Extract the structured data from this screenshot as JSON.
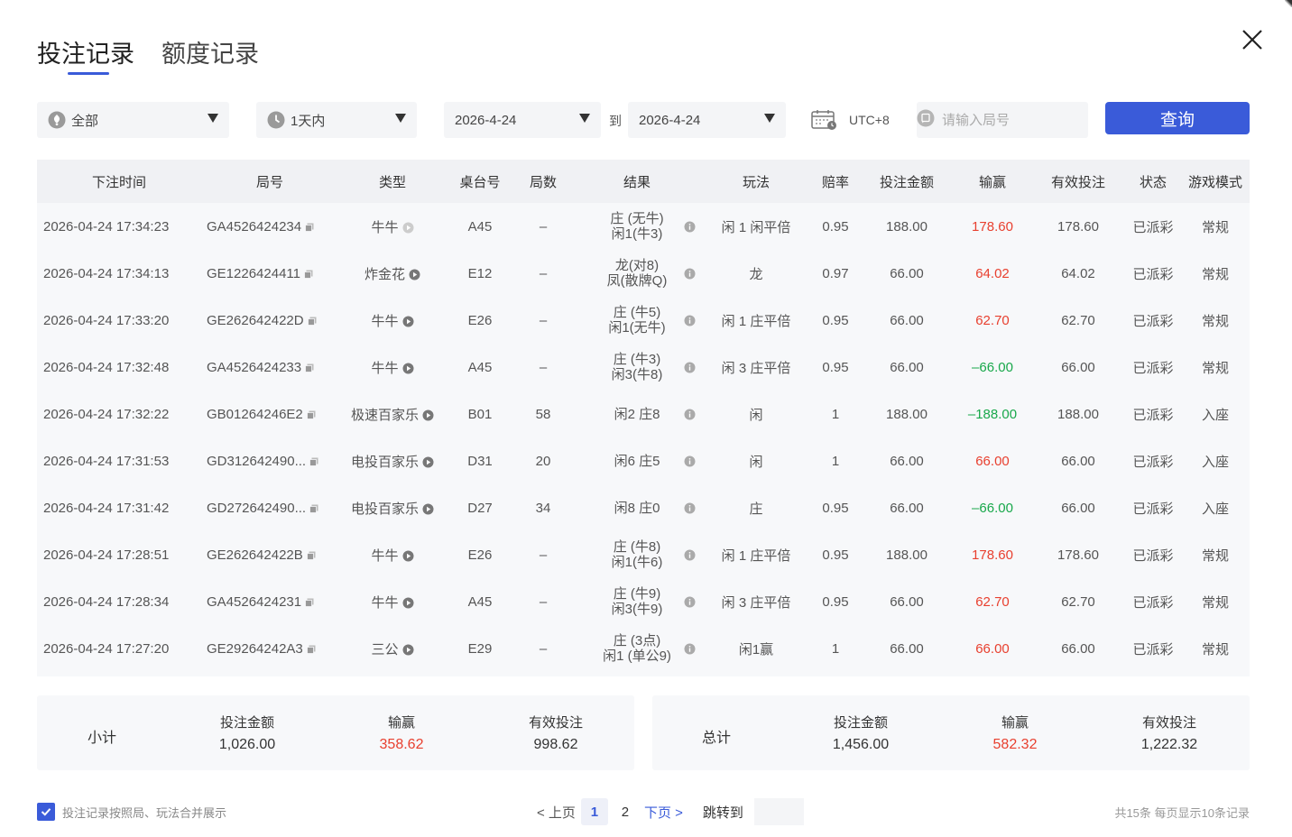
{
  "tabs": [
    {
      "label": "投注记录",
      "active": true
    },
    {
      "label": "额度记录",
      "active": false
    }
  ],
  "filters": {
    "game_type": "全部",
    "time_range": "1天内",
    "date_from": "2026-4-24",
    "to_label": "到",
    "date_to": "2026-4-24",
    "timezone": "UTC+8",
    "round_placeholder": "请输入局号",
    "query_label": "查询"
  },
  "columns": [
    "下注时间",
    "局号",
    "类型",
    "桌台号",
    "局数",
    "结果",
    "玩法",
    "赔率",
    "投注金额",
    "输赢",
    "有效投注",
    "状态",
    "游戏模式"
  ],
  "rows": [
    {
      "time": "2026-04-24 17:34:23",
      "round": "GA4526424234",
      "type": "牛牛",
      "play_enabled": false,
      "table": "A45",
      "count": "–",
      "result1": "庄 (无牛)",
      "result2": "闲1(牛3)",
      "bet_type": "闲 1 闲平倍",
      "odds": "0.95",
      "amount": "188.00",
      "winloss": "178.60",
      "wl_state": "win",
      "valid": "178.60",
      "status": "已派彩",
      "mode": "常规"
    },
    {
      "time": "2026-04-24 17:34:13",
      "round": "GE1226424411",
      "type": "炸金花",
      "play_enabled": true,
      "table": "E12",
      "count": "–",
      "result1": "龙(对8)",
      "result2": "凤(散牌Q)",
      "bet_type": "龙",
      "odds": "0.97",
      "amount": "66.00",
      "winloss": "64.02",
      "wl_state": "win",
      "valid": "64.02",
      "status": "已派彩",
      "mode": "常规"
    },
    {
      "time": "2026-04-24 17:33:20",
      "round": "GE262642422D",
      "type": "牛牛",
      "play_enabled": true,
      "table": "E26",
      "count": "–",
      "result1": "庄 (牛5)",
      "result2": "闲1(无牛)",
      "bet_type": "闲 1 庄平倍",
      "odds": "0.95",
      "amount": "66.00",
      "winloss": "62.70",
      "wl_state": "win",
      "valid": "62.70",
      "status": "已派彩",
      "mode": "常规"
    },
    {
      "time": "2026-04-24 17:32:48",
      "round": "GA4526424233",
      "type": "牛牛",
      "play_enabled": true,
      "table": "A45",
      "count": "–",
      "result1": "庄 (牛3)",
      "result2": "闲3(牛8)",
      "bet_type": "闲 3 庄平倍",
      "odds": "0.95",
      "amount": "66.00",
      "winloss": "–66.00",
      "wl_state": "lose",
      "valid": "66.00",
      "status": "已派彩",
      "mode": "常规"
    },
    {
      "time": "2026-04-24 17:32:22",
      "round": "GB01264246E2",
      "type": "极速百家乐",
      "play_enabled": true,
      "table": "B01",
      "count": "58",
      "result1": "闲2 庄8",
      "result2": "",
      "bet_type": "闲",
      "odds": "1",
      "amount": "188.00",
      "winloss": "–188.00",
      "wl_state": "lose",
      "valid": "188.00",
      "status": "已派彩",
      "mode": "入座"
    },
    {
      "time": "2026-04-24 17:31:53",
      "round": "GD312642490...",
      "type": "电投百家乐",
      "play_enabled": true,
      "table": "D31",
      "count": "20",
      "result1": "闲6 庄5",
      "result2": "",
      "bet_type": "闲",
      "odds": "1",
      "amount": "66.00",
      "winloss": "66.00",
      "wl_state": "win",
      "valid": "66.00",
      "status": "已派彩",
      "mode": "入座"
    },
    {
      "time": "2026-04-24 17:31:42",
      "round": "GD272642490...",
      "type": "电投百家乐",
      "play_enabled": true,
      "table": "D27",
      "count": "34",
      "result1": "闲8 庄0",
      "result2": "",
      "bet_type": "庄",
      "odds": "0.95",
      "amount": "66.00",
      "winloss": "–66.00",
      "wl_state": "lose",
      "valid": "66.00",
      "status": "已派彩",
      "mode": "入座"
    },
    {
      "time": "2026-04-24 17:28:51",
      "round": "GE262642422B",
      "type": "牛牛",
      "play_enabled": true,
      "table": "E26",
      "count": "–",
      "result1": "庄 (牛8)",
      "result2": "闲1(牛6)",
      "bet_type": "闲 1 庄平倍",
      "odds": "0.95",
      "amount": "188.00",
      "winloss": "178.60",
      "wl_state": "win",
      "valid": "178.60",
      "status": "已派彩",
      "mode": "常规"
    },
    {
      "time": "2026-04-24 17:28:34",
      "round": "GA4526424231",
      "type": "牛牛",
      "play_enabled": true,
      "table": "A45",
      "count": "–",
      "result1": "庄 (牛9)",
      "result2": "闲3(牛9)",
      "bet_type": "闲 3 庄平倍",
      "odds": "0.95",
      "amount": "66.00",
      "winloss": "62.70",
      "wl_state": "win",
      "valid": "62.70",
      "status": "已派彩",
      "mode": "常规"
    },
    {
      "time": "2026-04-24 17:27:20",
      "round": "GE29264242A3",
      "type": "三公",
      "play_enabled": true,
      "table": "E29",
      "count": "–",
      "result1": "庄 (3点)",
      "result2": "闲1 (单公9)",
      "bet_type": "闲1赢",
      "odds": "1",
      "amount": "66.00",
      "winloss": "66.00",
      "wl_state": "win",
      "valid": "66.00",
      "status": "已派彩",
      "mode": "常规"
    }
  ],
  "subtotal": {
    "label": "小计",
    "amount_label": "投注金额",
    "amount": "1,026.00",
    "winloss_label": "输赢",
    "winloss": "358.62",
    "valid_label": "有效投注",
    "valid": "998.62"
  },
  "total": {
    "label": "总计",
    "amount_label": "投注金额",
    "amount": "1,456.00",
    "winloss_label": "输赢",
    "winloss": "582.32",
    "valid_label": "有效投注",
    "valid": "1,222.32"
  },
  "footer": {
    "merge_label": "投注记录按照局、玩法合并展示",
    "merge_checked": true,
    "prev": "< 上页",
    "pages": [
      "1",
      "2"
    ],
    "current_page": "1",
    "next": "下页 >",
    "jump_label": "跳转到",
    "total_info": "共15条  每页显示10条记录"
  },
  "colors": {
    "accent": "#3a5bd9",
    "win": "#e8402f",
    "lose": "#19a84b"
  }
}
